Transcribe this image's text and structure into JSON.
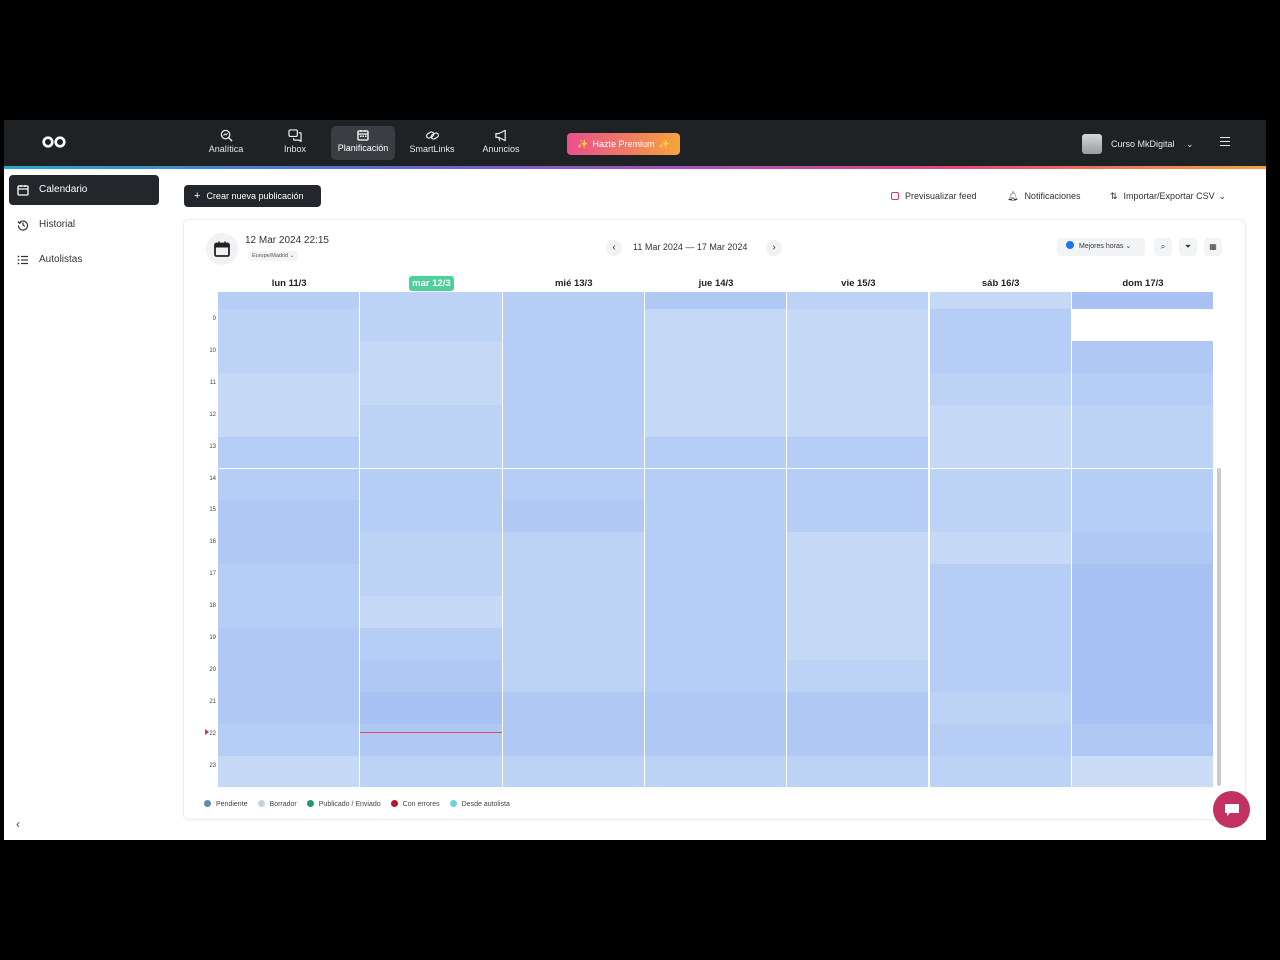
{
  "topbar": {
    "nav": [
      {
        "label": "Analítica",
        "icon": "analytics-icon"
      },
      {
        "label": "Inbox",
        "icon": "inbox-icon"
      },
      {
        "label": "Planificación",
        "icon": "calendar-icon"
      },
      {
        "label": "SmartLinks",
        "icon": "link-icon"
      },
      {
        "label": "Anuncios",
        "icon": "megaphone-icon"
      }
    ],
    "premium_label": "Hazte Premium",
    "user_name": "Curso MkDigital"
  },
  "sidebar": {
    "items": [
      {
        "label": "Calendario",
        "icon": "calendar-icon"
      },
      {
        "label": "Historial",
        "icon": "history-icon"
      },
      {
        "label": "Autolistas",
        "icon": "list-icon"
      }
    ]
  },
  "toolbar": {
    "create_label": "Crear nueva publicación",
    "preview_label": "Previsualizar feed",
    "notifications_label": "Notificaciones",
    "import_export_label": "Importar/Exportar CSV"
  },
  "calendar": {
    "current_datetime": "12 Mar 2024 22:15",
    "timezone": "Europe/Madrid",
    "range_label": "11 Mar 2024 — 17 Mar 2024",
    "best_hours_label": "Mejores horas",
    "days": [
      "lun 11/3",
      "mar 12/3",
      "mié 13/3",
      "jue 14/3",
      "vie 15/3",
      "sáb 16/3",
      "dom 17/3"
    ],
    "today_index": 1,
    "hours": [
      "9",
      "10",
      "11",
      "12",
      "13",
      "14",
      "15",
      "16",
      "17",
      "18",
      "19",
      "20",
      "21",
      "22",
      "23"
    ],
    "accent_color": "#4fcf9a",
    "now_line_color": "#e44a5c"
  },
  "legend": [
    {
      "label": "Pendiente",
      "color": "#5b8fa8"
    },
    {
      "label": "Borrador",
      "color": "#c9d3dc"
    },
    {
      "label": "Publicado / Enviado",
      "color": "#1e9a6b"
    },
    {
      "label": "Con errores",
      "color": "#c0112b"
    },
    {
      "label": "Desde autolista",
      "color": "#6fd0d9"
    }
  ]
}
